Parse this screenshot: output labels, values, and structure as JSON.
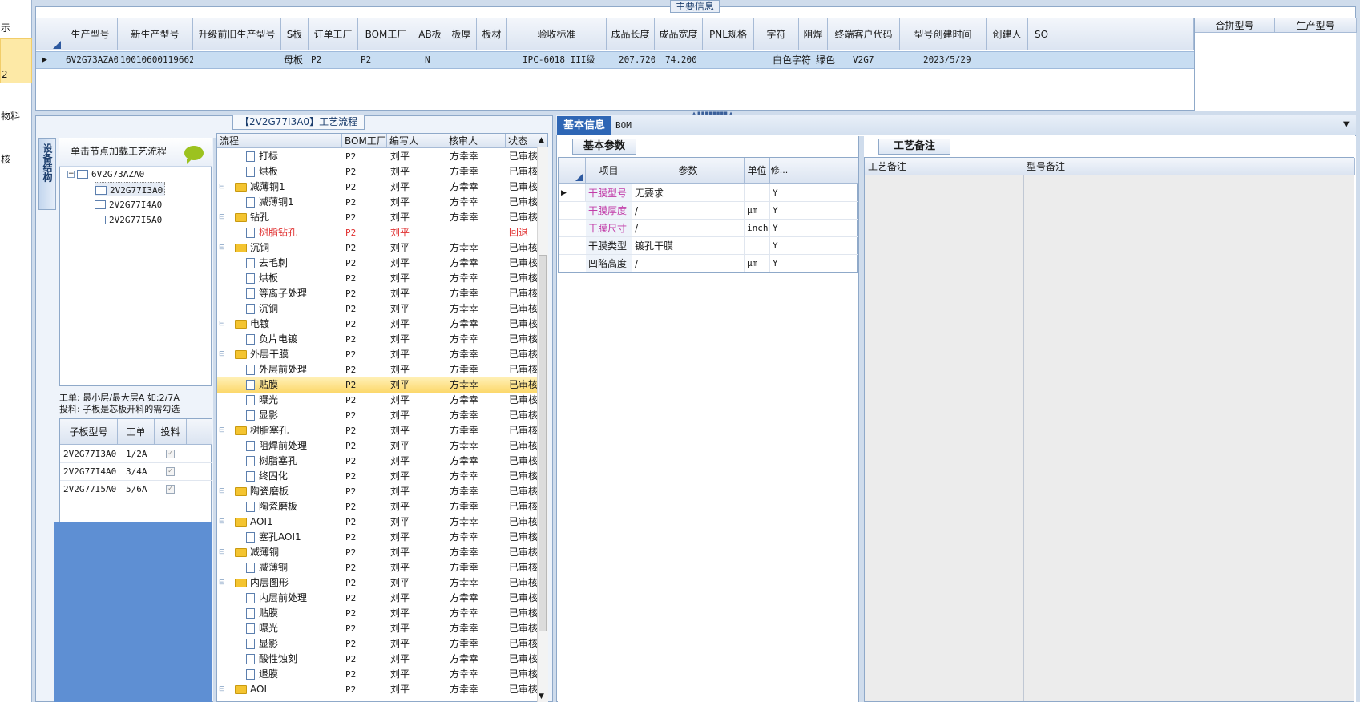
{
  "nav": [
    "示",
    "2",
    "物料",
    "核"
  ],
  "main_info": {
    "title": "主要信息",
    "columns": [
      "生产型号",
      "新生产型号",
      "升级前旧生产型号",
      "S板",
      "订单工厂",
      "BOM工厂",
      "AB板",
      "板厚",
      "板材",
      "验收标准",
      "成品长度",
      "成品宽度",
      "PNL规格",
      "字符",
      "阻焊",
      "终端客户代码",
      "型号创建时间",
      "创建人",
      "SO"
    ],
    "row": {
      "prod_model": "6V2G73AZA0",
      "new_model": "10010600119662",
      "old_model": "",
      "s_board": "母板",
      "order_factory": "P2",
      "bom_factory": "P2",
      "ab": "N",
      "thickness": "",
      "material": "",
      "standard": "IPC-6018 III级",
      "length": "207.720",
      "width": "74.200",
      "pnl": "",
      "char": "白色字符",
      "solder": "绿色",
      "customer": "V2G7",
      "created": "2023/5/29",
      "creator": "",
      "so": ""
    },
    "merge_columns": [
      "合拼型号",
      "生产型号"
    ]
  },
  "process": {
    "title": "【2V2G77I3A0】工艺流程",
    "device_tab": "设备结构",
    "load_hint": "单击节点加载工艺流程",
    "tree": {
      "root": "6V2G73AZA0",
      "children": [
        "2V2G77I3A0",
        "2V2G77I4A0",
        "2V2G77I5A0"
      ]
    },
    "work_note_1": "工单: 最小层/最大层A 如:2/7A",
    "work_note_2": "投料: 子板是芯板开料的需勾选",
    "sub_columns": [
      "子板型号",
      "工单",
      "投料"
    ],
    "sub_rows": [
      {
        "model": "2V2G77I3A0",
        "order": "1/2A",
        "check": "✓"
      },
      {
        "model": "2V2G77I4A0",
        "order": "3/4A",
        "check": "✓"
      },
      {
        "model": "2V2G77I5A0",
        "order": "5/6A",
        "check": "✓"
      }
    ],
    "grid_columns": [
      "流程",
      "BOM工厂",
      "编写人",
      "核审人",
      "状态"
    ],
    "rows": [
      {
        "name": "打标",
        "lvl": 2,
        "bom": "P2",
        "writer": "刘平",
        "reviewer": "方幸幸",
        "status": "已审核"
      },
      {
        "name": "烘板",
        "lvl": 2,
        "bom": "P2",
        "writer": "刘平",
        "reviewer": "方幸幸",
        "status": "已审核"
      },
      {
        "name": "减薄铜1",
        "lvl": 1,
        "bom": "P2",
        "writer": "刘平",
        "reviewer": "方幸幸",
        "status": "已审核"
      },
      {
        "name": "减薄铜1",
        "lvl": 2,
        "bom": "P2",
        "writer": "刘平",
        "reviewer": "方幸幸",
        "status": "已审核"
      },
      {
        "name": "钻孔",
        "lvl": 1,
        "bom": "P2",
        "writer": "刘平",
        "reviewer": "方幸幸",
        "status": "已审核"
      },
      {
        "name": "树脂钻孔",
        "lvl": 2,
        "bom": "P2",
        "writer": "刘平",
        "reviewer": "",
        "status": "回退",
        "red": true
      },
      {
        "name": "沉铜",
        "lvl": 1,
        "bom": "P2",
        "writer": "刘平",
        "reviewer": "方幸幸",
        "status": "已审核"
      },
      {
        "name": "去毛刺",
        "lvl": 2,
        "bom": "P2",
        "writer": "刘平",
        "reviewer": "方幸幸",
        "status": "已审核"
      },
      {
        "name": "烘板",
        "lvl": 2,
        "bom": "P2",
        "writer": "刘平",
        "reviewer": "方幸幸",
        "status": "已审核"
      },
      {
        "name": "等离子处理",
        "lvl": 2,
        "bom": "P2",
        "writer": "刘平",
        "reviewer": "方幸幸",
        "status": "已审核"
      },
      {
        "name": "沉铜",
        "lvl": 2,
        "bom": "P2",
        "writer": "刘平",
        "reviewer": "方幸幸",
        "status": "已审核"
      },
      {
        "name": "电镀",
        "lvl": 1,
        "bom": "P2",
        "writer": "刘平",
        "reviewer": "方幸幸",
        "status": "已审核"
      },
      {
        "name": "负片电镀",
        "lvl": 2,
        "bom": "P2",
        "writer": "刘平",
        "reviewer": "方幸幸",
        "status": "已审核"
      },
      {
        "name": "外层干膜",
        "lvl": 1,
        "bom": "P2",
        "writer": "刘平",
        "reviewer": "方幸幸",
        "status": "已审核"
      },
      {
        "name": "外层前处理",
        "lvl": 2,
        "bom": "P2",
        "writer": "刘平",
        "reviewer": "方幸幸",
        "status": "已审核"
      },
      {
        "name": "贴膜",
        "lvl": 2,
        "bom": "P2",
        "writer": "刘平",
        "reviewer": "方幸幸",
        "status": "已审核",
        "hl": true
      },
      {
        "name": "曝光",
        "lvl": 2,
        "bom": "P2",
        "writer": "刘平",
        "reviewer": "方幸幸",
        "status": "已审核"
      },
      {
        "name": "显影",
        "lvl": 2,
        "bom": "P2",
        "writer": "刘平",
        "reviewer": "方幸幸",
        "status": "已审核"
      },
      {
        "name": "树脂塞孔",
        "lvl": 1,
        "bom": "P2",
        "writer": "刘平",
        "reviewer": "方幸幸",
        "status": "已审核"
      },
      {
        "name": "阻焊前处理",
        "lvl": 2,
        "bom": "P2",
        "writer": "刘平",
        "reviewer": "方幸幸",
        "status": "已审核"
      },
      {
        "name": "树脂塞孔",
        "lvl": 2,
        "bom": "P2",
        "writer": "刘平",
        "reviewer": "方幸幸",
        "status": "已审核"
      },
      {
        "name": "终固化",
        "lvl": 2,
        "bom": "P2",
        "writer": "刘平",
        "reviewer": "方幸幸",
        "status": "已审核"
      },
      {
        "name": "陶瓷磨板",
        "lvl": 1,
        "bom": "P2",
        "writer": "刘平",
        "reviewer": "方幸幸",
        "status": "已审核"
      },
      {
        "name": "陶瓷磨板",
        "lvl": 2,
        "bom": "P2",
        "writer": "刘平",
        "reviewer": "方幸幸",
        "status": "已审核"
      },
      {
        "name": "AOI1",
        "lvl": 1,
        "bom": "P2",
        "writer": "刘平",
        "reviewer": "方幸幸",
        "status": "已审核"
      },
      {
        "name": "塞孔AOI1",
        "lvl": 2,
        "bom": "P2",
        "writer": "刘平",
        "reviewer": "方幸幸",
        "status": "已审核"
      },
      {
        "name": "减薄铜",
        "lvl": 1,
        "bom": "P2",
        "writer": "刘平",
        "reviewer": "方幸幸",
        "status": "已审核"
      },
      {
        "name": "减薄铜",
        "lvl": 2,
        "bom": "P2",
        "writer": "刘平",
        "reviewer": "方幸幸",
        "status": "已审核"
      },
      {
        "name": "内层图形",
        "lvl": 1,
        "bom": "P2",
        "writer": "刘平",
        "reviewer": "方幸幸",
        "status": "已审核"
      },
      {
        "name": "内层前处理",
        "lvl": 2,
        "bom": "P2",
        "writer": "刘平",
        "reviewer": "方幸幸",
        "status": "已审核"
      },
      {
        "name": "贴膜",
        "lvl": 2,
        "bom": "P2",
        "writer": "刘平",
        "reviewer": "方幸幸",
        "status": "已审核"
      },
      {
        "name": "曝光",
        "lvl": 2,
        "bom": "P2",
        "writer": "刘平",
        "reviewer": "方幸幸",
        "status": "已审核"
      },
      {
        "name": "显影",
        "lvl": 2,
        "bom": "P2",
        "writer": "刘平",
        "reviewer": "方幸幸",
        "status": "已审核"
      },
      {
        "name": "酸性蚀刻",
        "lvl": 2,
        "bom": "P2",
        "writer": "刘平",
        "reviewer": "方幸幸",
        "status": "已审核"
      },
      {
        "name": "退膜",
        "lvl": 2,
        "bom": "P2",
        "writer": "刘平",
        "reviewer": "方幸幸",
        "status": "已审核"
      },
      {
        "name": "AOI",
        "lvl": 1,
        "bom": "P2",
        "writer": "刘平",
        "reviewer": "方幸幸",
        "status": "已审核"
      }
    ]
  },
  "info_tabs": {
    "basic": "基本信息",
    "bom": "BOM"
  },
  "basic_params": {
    "tab": "基本参数",
    "columns": [
      "项目",
      "参数",
      "单位",
      "修..."
    ],
    "rows": [
      {
        "item": "干膜型号",
        "param": "无要求",
        "unit": "",
        "mod": "Y",
        "magenta": true
      },
      {
        "item": "干膜厚度",
        "param": "/",
        "unit": "μm",
        "mod": "Y",
        "magenta": true
      },
      {
        "item": "干膜尺寸",
        "param": "/",
        "unit": "inch",
        "mod": "Y",
        "magenta": true
      },
      {
        "item": "干膜类型",
        "param": "镀孔干膜",
        "unit": "",
        "mod": "Y",
        "magenta": false
      },
      {
        "item": "凹陷高度",
        "param": "/",
        "unit": "μm",
        "mod": "Y",
        "magenta": false
      }
    ]
  },
  "remarks": {
    "tab": "工艺备注",
    "columns": [
      "工艺备注",
      "型号备注"
    ]
  }
}
